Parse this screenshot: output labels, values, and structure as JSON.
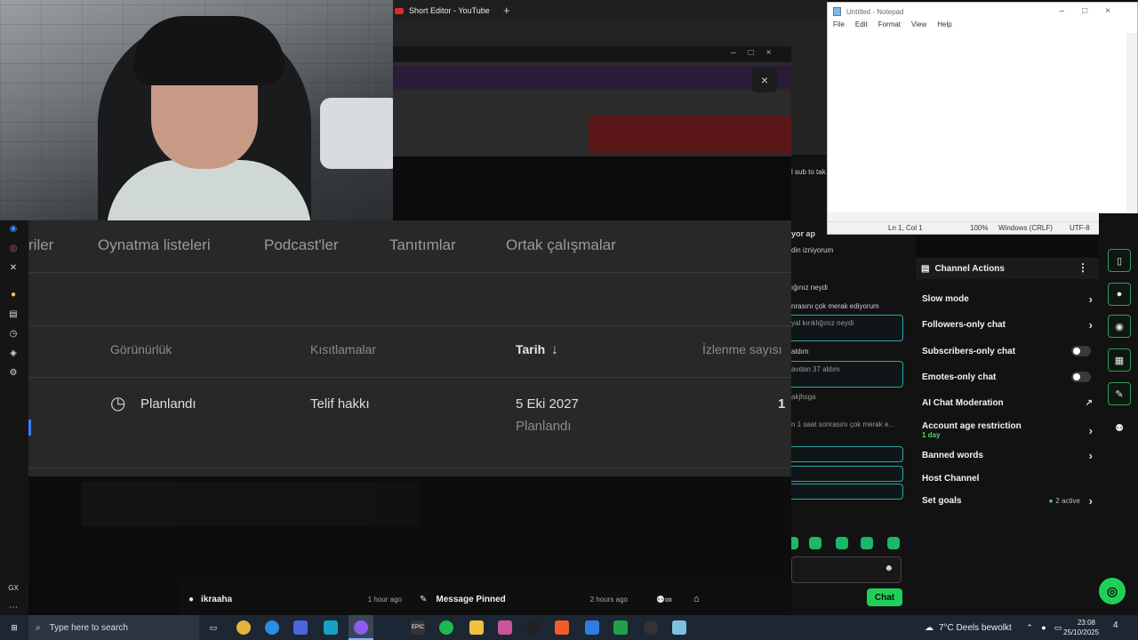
{
  "browser": {
    "tab_title": "Short Editor - YouTube",
    "new_tab": "+"
  },
  "studio": {
    "dialog_close": "×",
    "tabs": [
      "riler",
      "Oynatma listeleri",
      "Podcast'ler",
      "Tanıtımlar",
      "Ortak çalışmalar"
    ],
    "columns": [
      "Görünürlük",
      "Kısıtlamalar",
      "Tarih",
      "İzlenme sayısı"
    ],
    "sort_indicator": "↓",
    "row": {
      "visibility": "Planlandı",
      "restriction": "Telif hakkı",
      "date": "5 Eki 2027",
      "date_status": "Planlandı",
      "views": "1"
    }
  },
  "notepad": {
    "title": "Untitled - Notepad",
    "menu": [
      "File",
      "Edit",
      "Format",
      "View",
      "Help"
    ],
    "content": "",
    "status": {
      "position": "Ln 1, Col 1",
      "zoom": "100%",
      "line_ending": "Windows (CRLF)",
      "encoding": "UTF-8"
    }
  },
  "chat": {
    "lines": [
      "l sub to tak",
      "yor ap",
      "din izniyorum",
      "ığınız neydi",
      "nrasını çok merak ediyorum",
      "yal kırıklığınız neydi",
      "aldım",
      "avdan 37 aldım",
      "akjhsga",
      "n 1 saat sonrasını çok merak e..."
    ],
    "send_button": "Chat"
  },
  "channel_actions": {
    "title": "Channel Actions",
    "items": [
      {
        "label": "Slow mode",
        "control": "chevron"
      },
      {
        "label": "Followers-only chat",
        "control": "chevron"
      },
      {
        "label": "Subscribers-only chat",
        "control": "toggle"
      },
      {
        "label": "Emotes-only chat",
        "control": "toggle"
      },
      {
        "label": "AI Chat Moderation",
        "control": "external"
      },
      {
        "label": "Account age restriction",
        "sub": "1 day",
        "control": "chevron"
      },
      {
        "label": "Banned words",
        "control": "chevron"
      },
      {
        "label": "Host Channel",
        "control": "none"
      },
      {
        "label": "Set goals",
        "badge": "2 active",
        "control": "chevron"
      }
    ]
  },
  "dashboard_bar": {
    "user": "ikraaha",
    "user_time": "1 hour ago",
    "pinned": "Message Pinned",
    "pinned_time": "2 hours ago"
  },
  "taskbar": {
    "search_placeholder": "Type here to search",
    "weather": "7°C  Deels bewolkt",
    "time": "23:08",
    "date": "25/10/2025",
    "notif_count": "4"
  },
  "left_dock": {
    "gx": "GX"
  },
  "colors": {
    "accent_green": "#1fd058",
    "active_green": "#49d964",
    "chat_border": "#2aa7a7",
    "youtube_red": "#e12a2a"
  }
}
